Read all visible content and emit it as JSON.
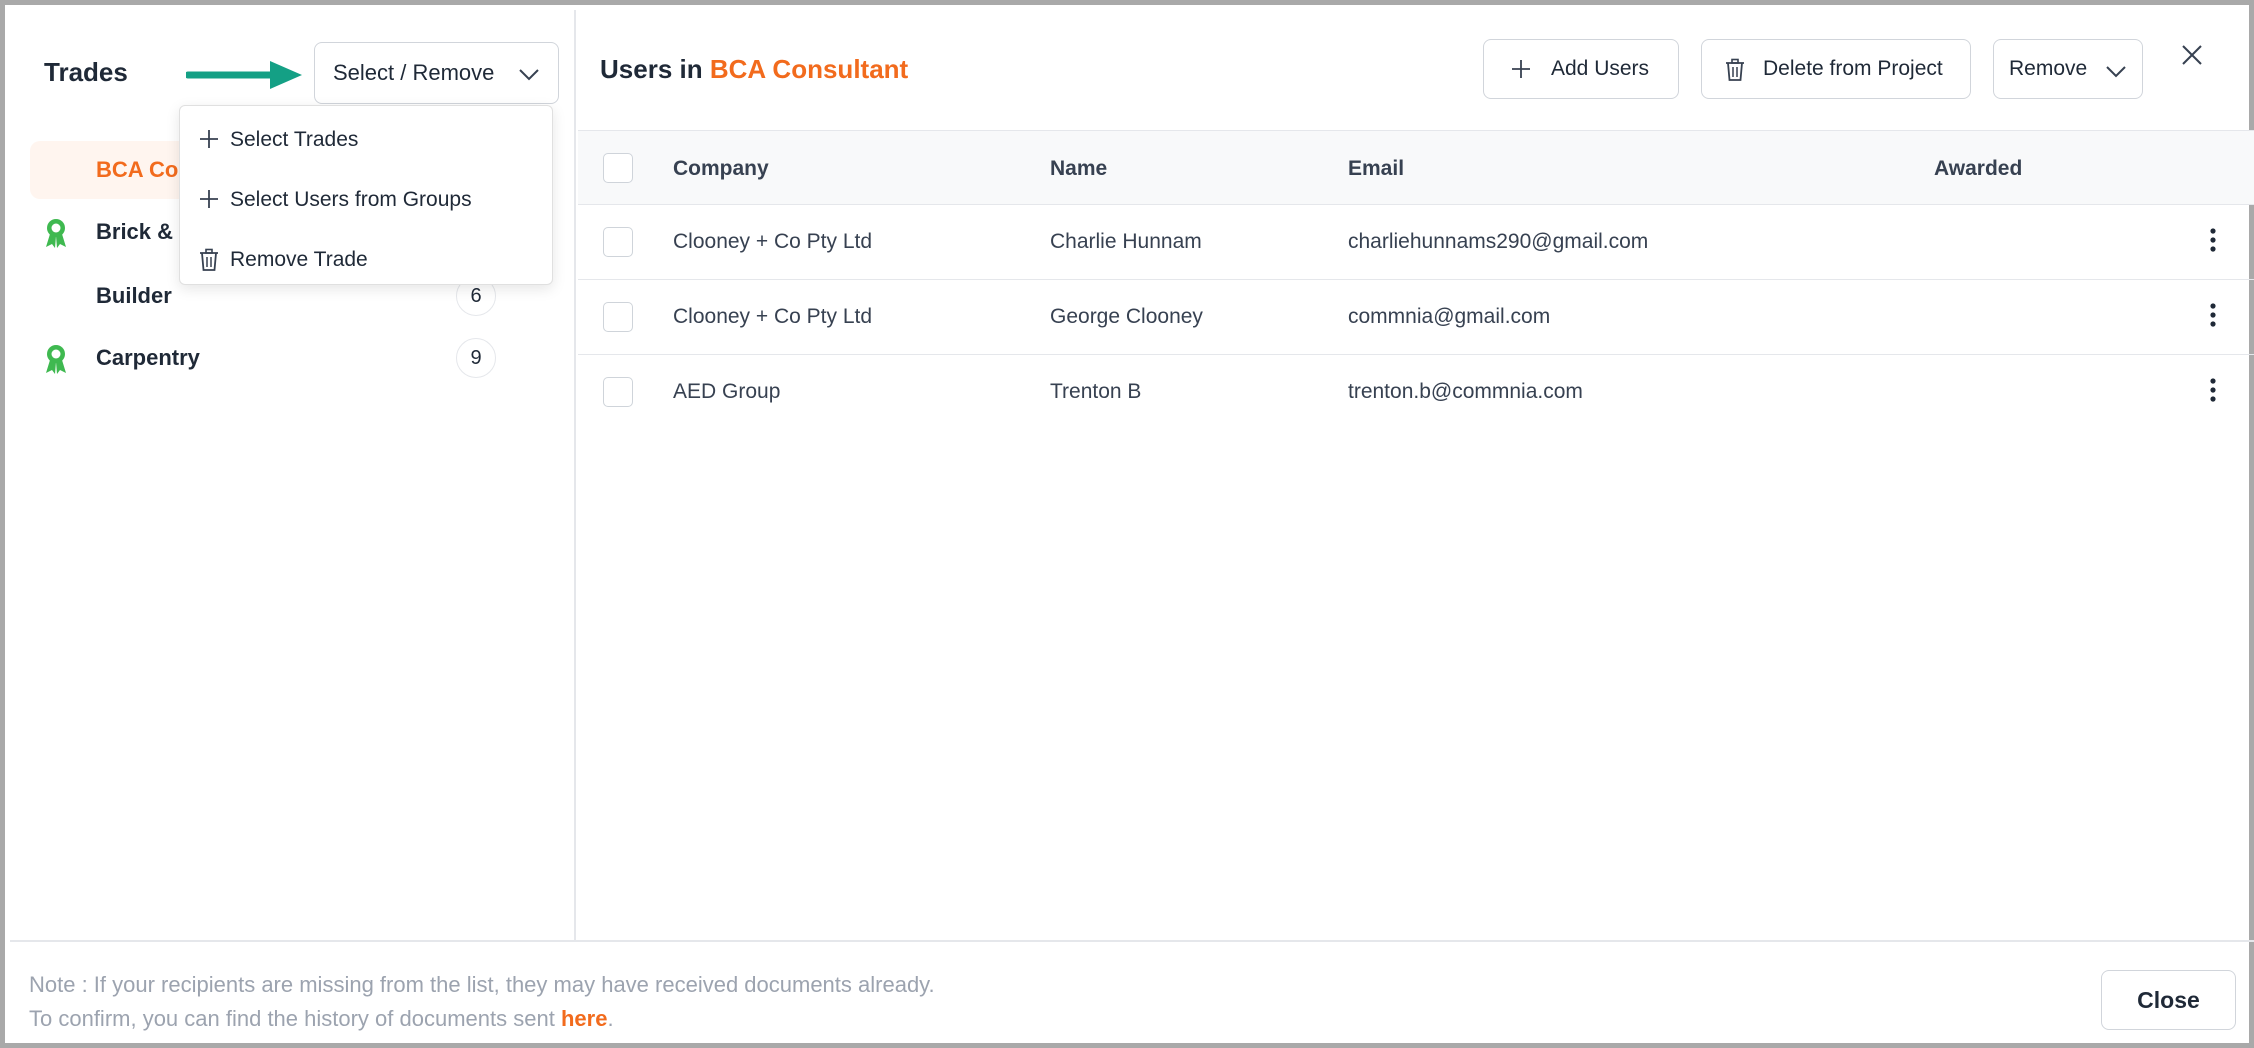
{
  "left": {
    "title": "Trades",
    "select_button": "Select / Remove",
    "trades": [
      {
        "name": "BCA Con",
        "count": "",
        "awarded": false,
        "active": true
      },
      {
        "name": "Brick & B",
        "count": "",
        "awarded": true,
        "active": false
      },
      {
        "name": "Builder",
        "count": "6",
        "awarded": false,
        "active": false
      },
      {
        "name": "Carpentry",
        "count": "9",
        "awarded": true,
        "active": false
      }
    ]
  },
  "menu": {
    "items": [
      {
        "label": "Select Trades",
        "icon": "plus-icon"
      },
      {
        "label": "Select Users from Groups",
        "icon": "plus-icon"
      },
      {
        "label": "Remove Trade",
        "icon": "trash-icon"
      }
    ]
  },
  "right": {
    "title_prefix": "Users in",
    "title_trade": "BCA Consultant",
    "add_users": "Add Users",
    "delete_from_project": "Delete from Project",
    "remove": "Remove",
    "columns": {
      "company": "Company",
      "name": "Name",
      "email": "Email",
      "awarded": "Awarded"
    },
    "rows": [
      {
        "company": "Clooney + Co Pty Ltd",
        "name": "Charlie Hunnam",
        "email": "charliehunnams290@gmail.com",
        "awarded": ""
      },
      {
        "company": "Clooney + Co Pty Ltd",
        "name": "George Clooney",
        "email": "commnia@gmail.com",
        "awarded": ""
      },
      {
        "company": "AED Group",
        "name": "Trenton B",
        "email": "trenton.b@commnia.com",
        "awarded": ""
      }
    ]
  },
  "footer": {
    "note_line1": "Note : If your recipients are missing from the list, they may have received documents already.",
    "note_line2_prefix": "To confirm, you can find the history of documents sent",
    "note_link": "here",
    "note_suffix": ".",
    "close": "Close"
  },
  "colors": {
    "accent": "#f26b1d",
    "ribbon": "#3fb950",
    "arrow": "#14a085"
  }
}
